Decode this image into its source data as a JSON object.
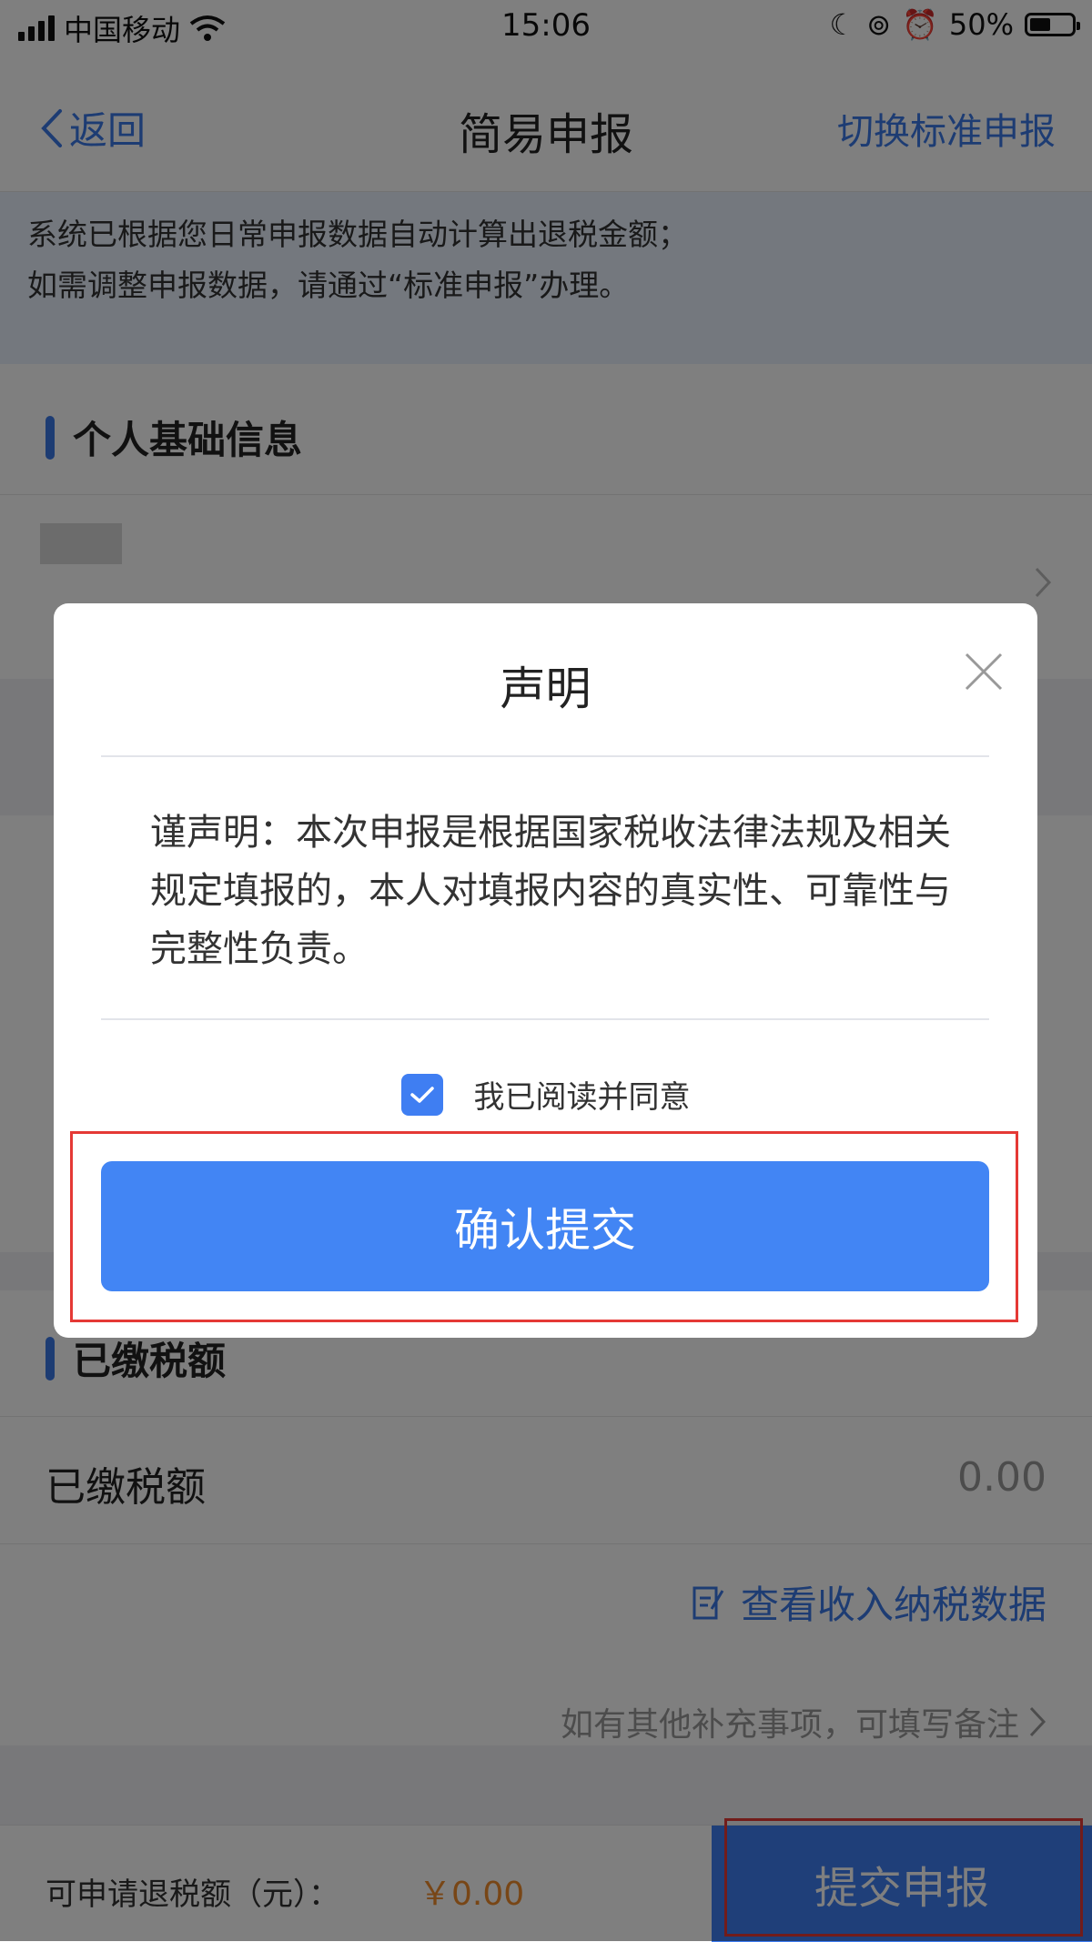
{
  "status_bar": {
    "carrier": "中国移动",
    "time": "15:06",
    "battery": "50%",
    "battery_level": 0.5
  },
  "navbar": {
    "back_label": "返回",
    "title": "简易申报",
    "switch_label": "切换标准申报"
  },
  "notice": {
    "line1": "系统已根据您日常申报数据自动计算出退税金额；",
    "line2": "如需调整申报数据，请通过“标准申报”办理。"
  },
  "personal_section": {
    "title": "个人基础信息"
  },
  "paid_section": {
    "title": "已缴税额",
    "row_label": "已缴税额",
    "row_value": "0.00"
  },
  "view_income_link": "查看收入纳税数据",
  "remark_hint": "如有其他补充事项，可填写备注",
  "footer": {
    "refund_label": "可申请退税额（元）：",
    "refund_amount": "￥0.00",
    "submit_label": "提交申报"
  },
  "dialog": {
    "title": "声明",
    "body": "谨声明：本次申报是根据国家税收法律法规及相关规定填报的，本人对填报内容的真实性、可靠性与完整性负责。",
    "agree_label": "我已阅读并同意",
    "confirm_label": "确认提交"
  },
  "colors": {
    "accent": "#3f7ef2",
    "highlight": "#e53935",
    "amount": "#f08c2c"
  }
}
